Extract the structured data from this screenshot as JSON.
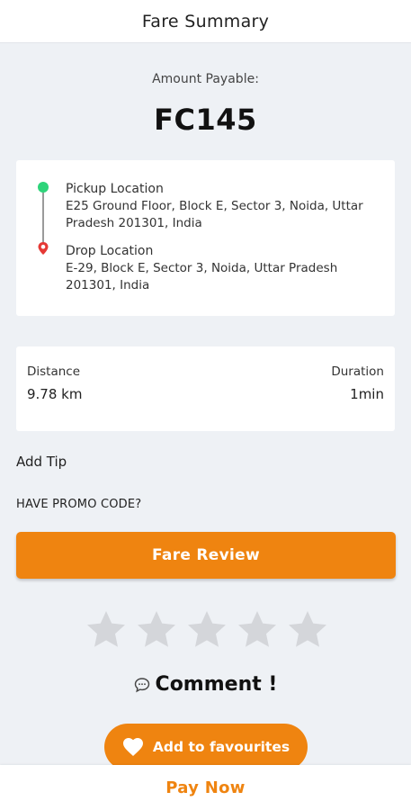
{
  "header": {
    "title": "Fare Summary"
  },
  "amount": {
    "label": "Amount Payable:",
    "value": "FC145"
  },
  "locations": {
    "pickup": {
      "title": "Pickup Location",
      "address": "E25 Ground Floor, Block E, Sector 3, Noida, Uttar Pradesh 201301, India"
    },
    "drop": {
      "title": "Drop Location",
      "address": "E-29, Block E, Sector 3, Noida, Uttar Pradesh 201301, India"
    }
  },
  "trip": {
    "distance_label": "Distance",
    "distance_value": "9.78 km",
    "duration_label": "Duration",
    "duration_value": "1min"
  },
  "actions": {
    "add_tip": "Add Tip",
    "promo": "HAVE PROMO CODE?",
    "fare_review": "Fare Review",
    "comment": "Comment !",
    "add_favourites": "Add to favourites",
    "pay_now": "Pay Now"
  },
  "rating": {
    "max_stars": 5,
    "selected": 0
  },
  "icons": {
    "pickup": "green-dot-icon",
    "drop": "red-pin-icon",
    "star": "star-icon",
    "comment": "comment-icon",
    "heart": "heart-icon"
  },
  "colors": {
    "accent": "#ef8410",
    "background": "#eef1f5",
    "pickup_dot": "#2ed47a",
    "drop_pin": "#e53935",
    "star_empty": "#d4d6da"
  }
}
